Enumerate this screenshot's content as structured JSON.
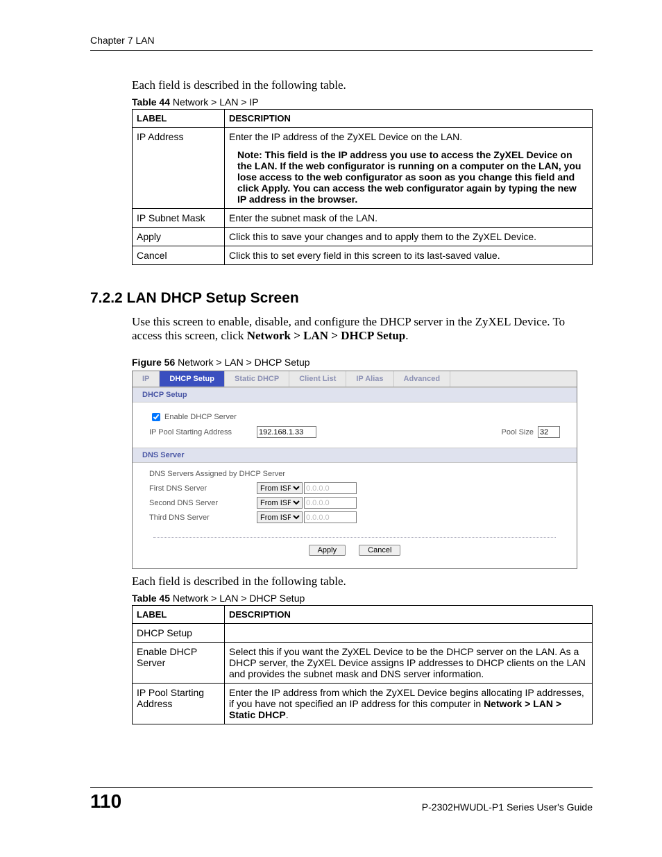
{
  "header": {
    "chapter": "Chapter 7 LAN"
  },
  "intro1": "Each field is described in the following table.",
  "table44": {
    "caption_bold": "Table 44",
    "caption_rest": "   Network > LAN > IP",
    "head": {
      "label": "LABEL",
      "desc": "DESCRIPTION"
    },
    "rows": [
      {
        "label": "IP Address",
        "desc": "Enter the IP address of the ZyXEL Device on the LAN.",
        "note": "Note: This field is the IP address you use to access the ZyXEL Device on the LAN. If the web configurator is running on a computer on the LAN, you lose access to the web configurator as soon as you change this field and click Apply. You can access the web configurator again by typing the new IP address in the browser."
      },
      {
        "label": "IP Subnet Mask",
        "desc": "Enter the subnet mask of the LAN."
      },
      {
        "label": "Apply",
        "desc": "Click this to save your changes and to apply them to the ZyXEL Device."
      },
      {
        "label": "Cancel",
        "desc": "Click this to set every field in this screen to its last-saved value."
      }
    ]
  },
  "section722": {
    "title": "7.2.2  LAN DHCP Setup Screen",
    "para_a": "Use this screen to enable, disable, and configure the DHCP server in the ZyXEL Device. To access this screen, click ",
    "para_b_bold": "Network > LAN > DHCP Setup",
    "para_c": "."
  },
  "figure56": {
    "caption_bold": "Figure 56",
    "caption_rest": "   Network > LAN > DHCP Setup",
    "tabs": [
      "IP",
      "DHCP Setup",
      "Static DHCP",
      "Client List",
      "IP Alias",
      "Advanced"
    ],
    "active_tab_index": 1,
    "dhcp_section_title": "DHCP Setup",
    "enable_label": "Enable DHCP Server",
    "pool_start_label": "IP Pool Starting Address",
    "pool_start_value": "192.168.1.33",
    "pool_size_label": "Pool Size",
    "pool_size_value": "32",
    "dns_section_title": "DNS Server",
    "dns_assigned_label": "DNS Servers Assigned by DHCP Server",
    "dns_rows": [
      {
        "label": "First DNS Server",
        "mode": "From ISP",
        "ip": "0.0.0.0"
      },
      {
        "label": "Second DNS Server",
        "mode": "From ISP",
        "ip": "0.0.0.0"
      },
      {
        "label": "Third DNS Server",
        "mode": "From ISP",
        "ip": "0.0.0.0"
      }
    ],
    "apply": "Apply",
    "cancel": "Cancel"
  },
  "intro2": "Each field is described in the following table.",
  "table45": {
    "caption_bold": "Table 45",
    "caption_rest": "   Network > LAN > DHCP Setup",
    "head": {
      "label": "LABEL",
      "desc": "DESCRIPTION"
    },
    "rows": [
      {
        "label": "DHCP Setup",
        "desc": ""
      },
      {
        "label": "Enable DHCP Server",
        "desc": "Select this if you want the ZyXEL Device to be the DHCP server on the LAN. As a DHCP server, the ZyXEL Device assigns IP addresses to DHCP clients on the LAN and provides the subnet mask and DNS server information."
      },
      {
        "label": "IP Pool Starting Address",
        "desc_a": "Enter the IP address from which the ZyXEL Device begins allocating IP addresses, if you have not specified an IP address for this computer in ",
        "desc_b_bold": "Network > LAN > Static DHCP",
        "desc_c": "."
      }
    ]
  },
  "footer": {
    "page": "110",
    "guide": "P-2302HWUDL-P1 Series User's Guide"
  }
}
